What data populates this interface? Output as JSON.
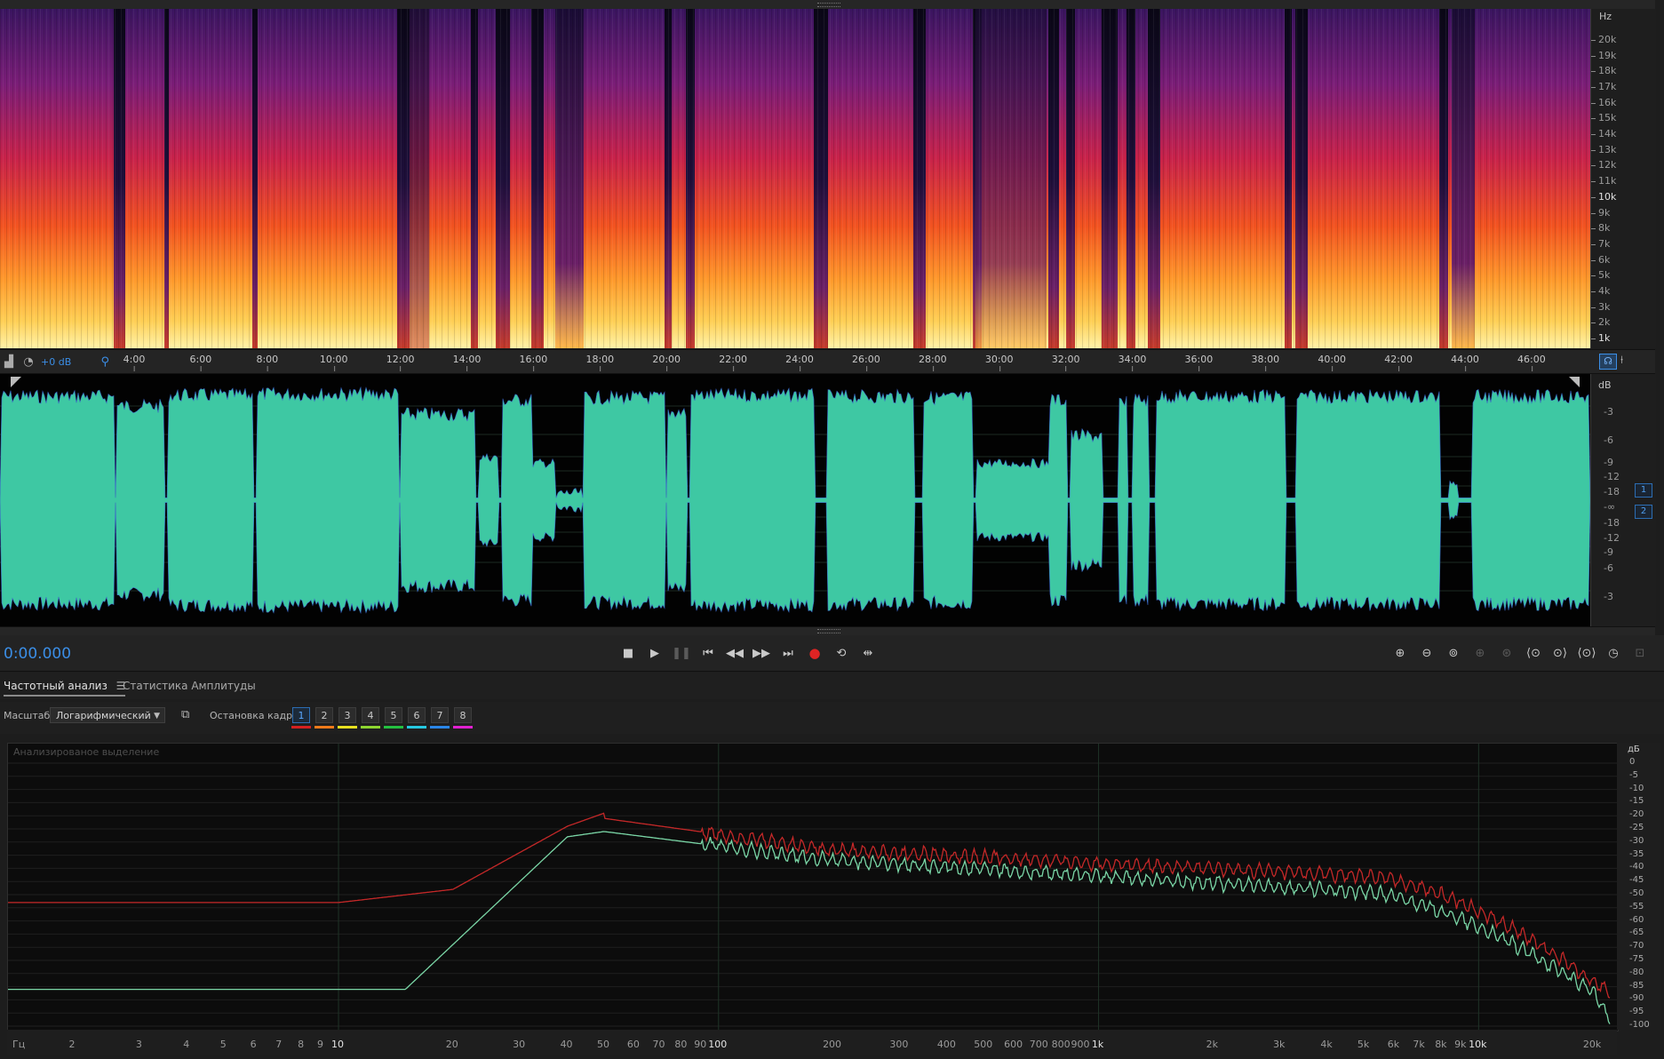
{
  "spectrogram": {
    "unit_label": "Hz",
    "freq_ticks": [
      "20k",
      "19k",
      "18k",
      "17k",
      "16k",
      "15k",
      "14k",
      "13k",
      "12k",
      "11k",
      "10k",
      "9k",
      "8k",
      "7k",
      "6k",
      "5k",
      "4k",
      "3k",
      "2k",
      "1k"
    ]
  },
  "timeline": {
    "gain_label": "+0 dB",
    "ticks": [
      "4:00",
      "6:00",
      "8:00",
      "10:00",
      "12:00",
      "14:00",
      "16:00",
      "18:00",
      "20:00",
      "22:00",
      "24:00",
      "26:00",
      "28:00",
      "30:00",
      "32:00",
      "34:00",
      "36:00",
      "38:00",
      "40:00",
      "42:00",
      "44:00",
      "46:00"
    ]
  },
  "waveform": {
    "unit_label": "dB",
    "db_ticks": [
      "-3",
      "-6",
      "-9",
      "-12",
      "-18",
      "-∞",
      "-18",
      "-12",
      "-9",
      "-6",
      "-3"
    ],
    "channels": [
      "1",
      "2"
    ]
  },
  "transport": {
    "time": "0:00.000",
    "buttons": [
      "stop-icon",
      "play-icon",
      "pause-icon",
      "go-start-icon",
      "rewind-icon",
      "fast-forward-icon",
      "go-end-icon",
      "record-icon",
      "loop-icon",
      "skip-selection-icon"
    ],
    "zoom_buttons": [
      "zoom-in-amplitude-icon",
      "zoom-out-amplitude-icon",
      "zoom-reset-icon",
      "zoom-in-time-icon",
      "zoom-out-time-icon",
      "zoom-selection-icon",
      "zoom-in-point-icon",
      "zoom-out-full-icon",
      "zoom-history-icon",
      "zoom-fit-icon"
    ]
  },
  "panel": {
    "tabs": [
      {
        "label": "Частотный анализ",
        "active": true
      },
      {
        "label": "Статистика Амплитуды",
        "active": false
      }
    ],
    "scale_label": "Масштаб:",
    "scale_value": "Логарифмический",
    "freeze_label": "Остановка кадра:",
    "frames": [
      "1",
      "2",
      "3",
      "4",
      "5",
      "6",
      "7",
      "8"
    ],
    "frame_colors": [
      "#d42020",
      "#f07a1a",
      "#e8e020",
      "#8ed630",
      "#24c040",
      "#26c8e0",
      "#2a86e8",
      "#e020d0"
    ]
  },
  "freq_plot": {
    "caption": "Анализированое выделение",
    "db_unit": "дБ",
    "db_ticks": [
      "0",
      "-5",
      "-10",
      "-15",
      "-20",
      "-25",
      "-30",
      "-35",
      "-40",
      "-45",
      "-50",
      "-55",
      "-60",
      "-65",
      "-70",
      "-75",
      "-80",
      "-85",
      "-90",
      "-95",
      "-100"
    ],
    "freq_unit": "Гц",
    "freq_ticks": [
      "2",
      "3",
      "4",
      "5",
      "6",
      "7",
      "8",
      "9",
      "10",
      "20",
      "30",
      "40",
      "50",
      "60",
      "70",
      "80",
      "90",
      "100",
      "200",
      "300",
      "400",
      "500",
      "600",
      "700",
      "800",
      "900",
      "1k",
      "2k",
      "3k",
      "4k",
      "5k",
      "6k",
      "7k",
      "8k",
      "9k",
      "10k",
      "20k"
    ],
    "colors": {
      "red_series": "#c42828",
      "green_series": "#7ad6a6"
    }
  }
}
